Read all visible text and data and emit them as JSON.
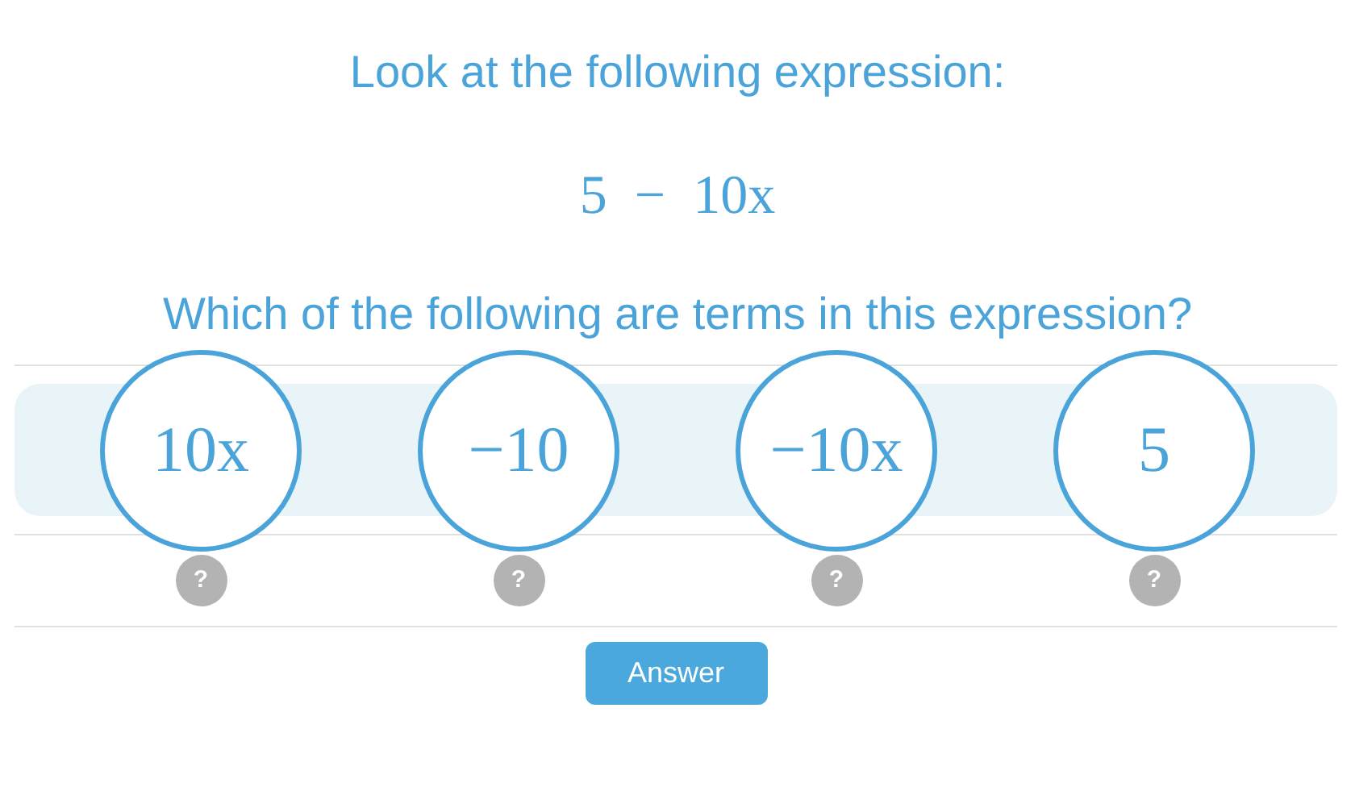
{
  "prompt": "Look at the following expression:",
  "expression": "5 − 10x",
  "question": "Which of the following are terms in this expression?",
  "options": [
    {
      "label": "10x",
      "selected": false,
      "hint": "?"
    },
    {
      "label": "−10",
      "selected": false,
      "hint": "?"
    },
    {
      "label": "−10x",
      "selected": false,
      "hint": "?"
    },
    {
      "label": "5",
      "selected": false,
      "hint": "?"
    }
  ],
  "answer_button": "Answer"
}
